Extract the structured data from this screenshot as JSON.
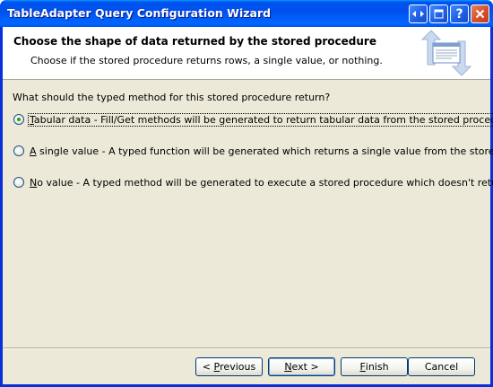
{
  "window": {
    "title": "TableAdapter Query Configuration Wizard",
    "title_buttons": [
      "restore-icon",
      "maximize-icon",
      "help-icon",
      "close-icon"
    ],
    "help_glyph": "?"
  },
  "header": {
    "title": "Choose the shape of data returned by the stored procedure",
    "subtitle": "Choose if the stored procedure returns rows, a single value, or nothing.",
    "icon": "stored-procedure-wizard-icon"
  },
  "question": "What should the typed method for this stored procedure return?",
  "options": [
    {
      "accel": "T",
      "text": "abular data - Fill/Get methods will be generated to return tabular data from the stored procedure.",
      "checked": true
    },
    {
      "accel": "A",
      "text": " single value - A typed function will be generated which returns a single value from the stored procedure.",
      "checked": false
    },
    {
      "accel": "N",
      "text": "o value - A typed method will be generated to execute a stored procedure which doesn't return data.",
      "checked": false
    }
  ],
  "buttons": {
    "previous": {
      "pre": "< ",
      "accel": "P",
      "post": "revious"
    },
    "next": {
      "pre": "",
      "accel": "N",
      "post": "ext >"
    },
    "finish": {
      "pre": "",
      "accel": "F",
      "post": "inish"
    },
    "cancel": {
      "label": "Cancel"
    }
  },
  "colors": {
    "titlebar": "#0054e3",
    "dialog_bg": "#ece9d8",
    "radio_dot": "#21a121",
    "close_button": "#d6502a"
  }
}
